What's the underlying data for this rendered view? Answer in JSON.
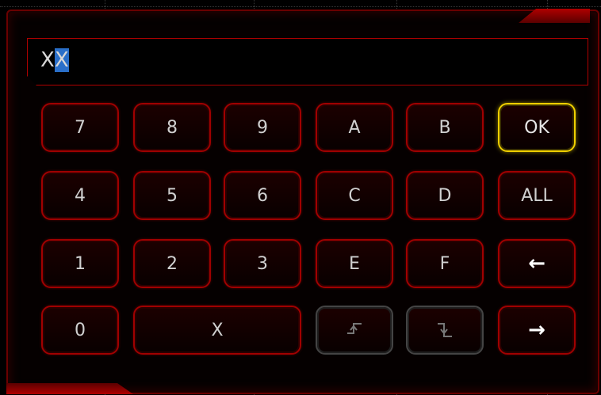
{
  "input": {
    "prefix": "X",
    "cursor": "X"
  },
  "keys": {
    "k7": "7",
    "k8": "8",
    "k9": "9",
    "kA": "A",
    "kB": "B",
    "ok": "OK",
    "k4": "4",
    "k5": "5",
    "k6": "6",
    "kC": "C",
    "kD": "D",
    "all": "ALL",
    "k1": "1",
    "k2": "2",
    "k3": "3",
    "kE": "E",
    "kF": "F",
    "backspace": "←",
    "k0": "0",
    "kX": "X",
    "right": "→"
  },
  "icons": {
    "rising_edge": "rising-edge-icon",
    "falling_edge": "falling-edge-icon"
  },
  "colors": {
    "frame": "#a00000",
    "ok_highlight": "#f0d000",
    "cursor": "#2a6fc9"
  }
}
